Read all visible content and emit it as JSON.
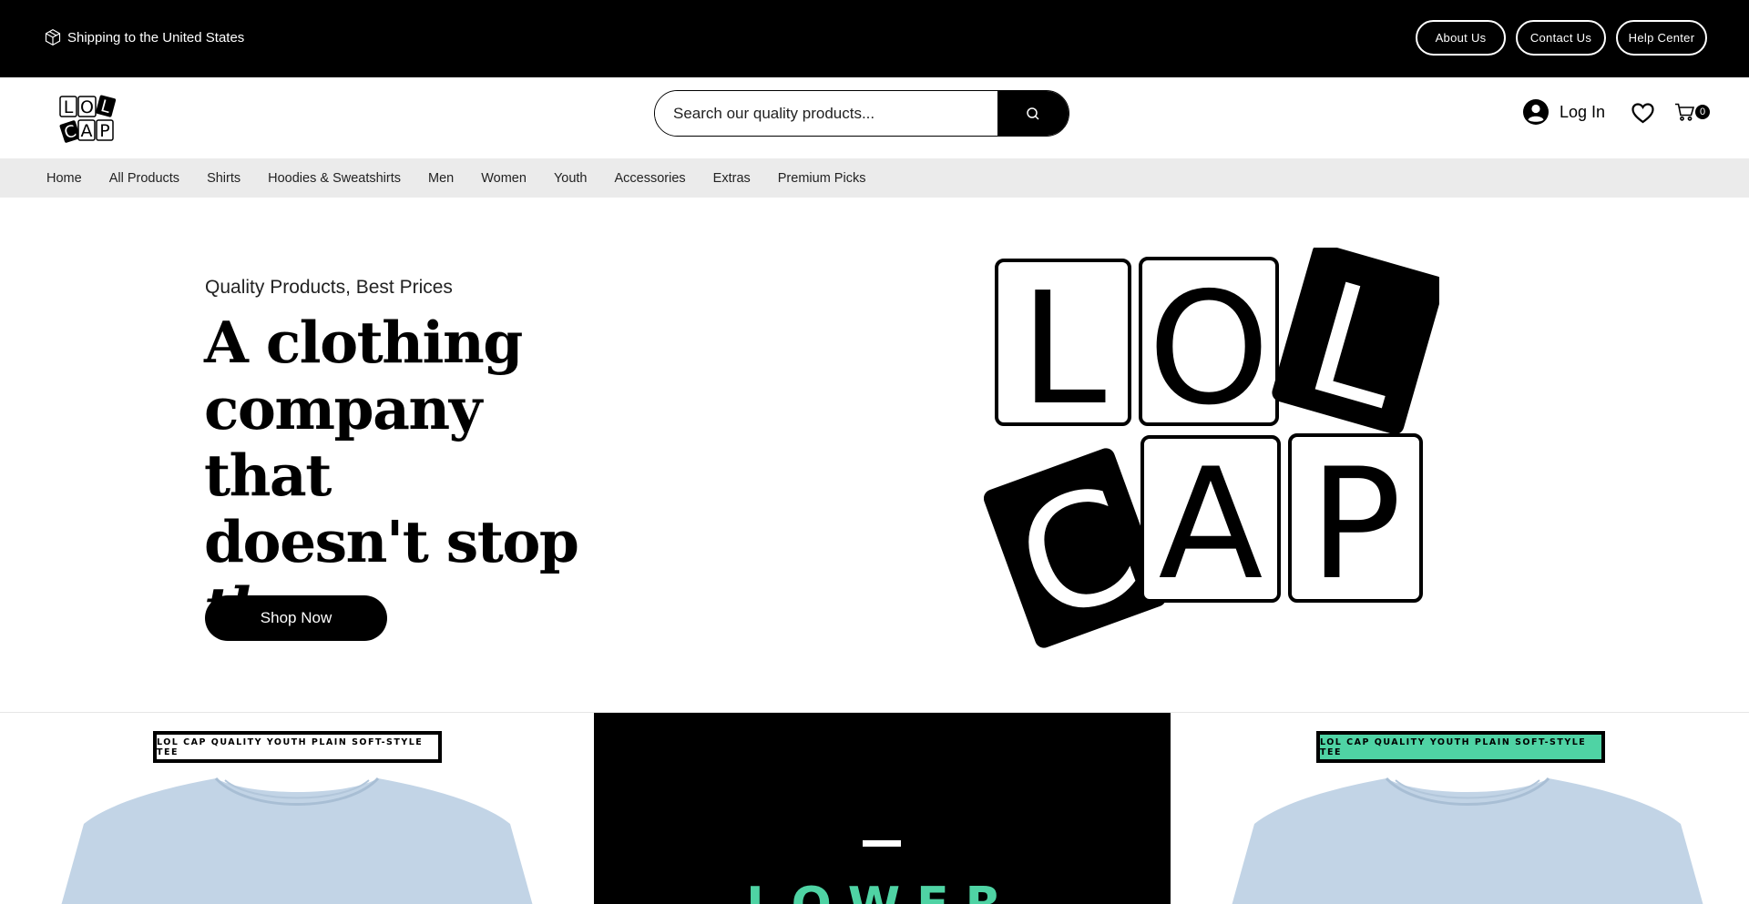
{
  "topbar": {
    "shipping_text": "Shipping to the United States",
    "links": {
      "about": "About Us",
      "contact": "Contact Us",
      "help": "Help Center"
    }
  },
  "header": {
    "logo_text": "LOL CAP",
    "search_placeholder": "Search our quality products...",
    "login_label": "Log In",
    "cart_count": "0"
  },
  "nav": {
    "items": [
      "Home",
      "All Products",
      "Shirts",
      "Hoodies & Sweatshirts",
      "Men",
      "Women",
      "Youth",
      "Accessories",
      "Extras",
      "Premium Picks"
    ]
  },
  "hero": {
    "subtitle": "Quality Products, Best Prices",
    "title_line1": "A clothing",
    "title_line2": "company that",
    "title_line3": "doesn't stop",
    "title_line4": "there",
    "cta": "Shop Now"
  },
  "products": {
    "left_tag": "LOL CAP QUALITY YOUTH PLAIN SOFT-STYLE TEE",
    "promo_dash": "—",
    "promo_text": "LOWER",
    "right_tag": "LOL CAP QUALITY YOUTH PLAIN SOFT-STYLE TEE"
  },
  "colors": {
    "accent_green": "#4fd3a4",
    "tee_blue": "#c2d4e6",
    "nav_bg": "#ebebeb",
    "topbar_bg": "#000000"
  }
}
